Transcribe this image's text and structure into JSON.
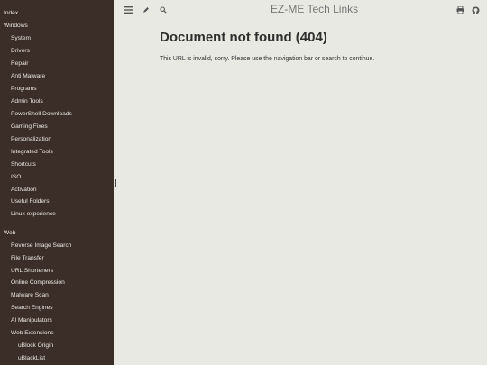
{
  "sidebar": {
    "items": [
      {
        "label": "Index",
        "level": 0
      },
      {
        "label": "Windows",
        "level": 0
      },
      {
        "label": "System",
        "level": 1
      },
      {
        "label": "Drivers",
        "level": 1
      },
      {
        "label": "Repair",
        "level": 1
      },
      {
        "label": "Anti Malware",
        "level": 1
      },
      {
        "label": "Programs",
        "level": 1
      },
      {
        "label": "Admin Tools",
        "level": 1
      },
      {
        "label": "PowerShell Downloads",
        "level": 1
      },
      {
        "label": "Gaming Fixes",
        "level": 1
      },
      {
        "label": "Personalization",
        "level": 1
      },
      {
        "label": "Integrated Tools",
        "level": 1
      },
      {
        "label": "Shortcuts",
        "level": 1
      },
      {
        "label": "ISO",
        "level": 1
      },
      {
        "label": "Activation",
        "level": 1
      },
      {
        "label": "Useful Folders",
        "level": 1
      },
      {
        "label": "Linux experience",
        "level": 1
      },
      {
        "label": "Web",
        "level": 0
      },
      {
        "label": "Reverse Image Search",
        "level": 1
      },
      {
        "label": "File Transfer",
        "level": 1
      },
      {
        "label": "URL Shorteners",
        "level": 1
      },
      {
        "label": "Online Compression",
        "level": 1
      },
      {
        "label": "Malware Scan",
        "level": 1
      },
      {
        "label": "Search Engines",
        "level": 1
      },
      {
        "label": "AI Manipulators",
        "level": 1
      },
      {
        "label": "Web Extensions",
        "level": 1
      },
      {
        "label": "uBlock Origin",
        "level": 2
      },
      {
        "label": "uBlackList",
        "level": 2
      }
    ]
  },
  "header": {
    "title": "EZ-ME Tech Links",
    "icons": [
      "menu-icon",
      "edit-icon",
      "search-icon",
      "print-icon",
      "github-icon"
    ]
  },
  "main": {
    "heading": "Document not found (404)",
    "message": "This URL is invalid, sorry. Please use the navigation bar or search to continue."
  }
}
